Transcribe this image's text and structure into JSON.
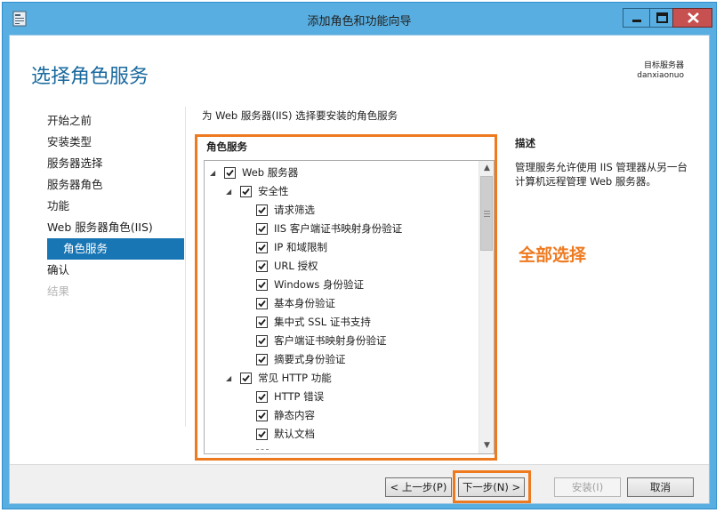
{
  "window": {
    "title": "添加角色和功能向导",
    "minimize_glyph": "minimize-icon",
    "maximize_glyph": "maximize-icon",
    "close_glyph": "close-icon"
  },
  "header": {
    "page_title": "选择角色服务",
    "target_label": "目标服务器",
    "target_server": "danxiaonuo"
  },
  "nav": {
    "items": [
      {
        "label": "开始之前",
        "state": "normal"
      },
      {
        "label": "安装类型",
        "state": "normal"
      },
      {
        "label": "服务器选择",
        "state": "normal"
      },
      {
        "label": "服务器角色",
        "state": "normal"
      },
      {
        "label": "功能",
        "state": "normal"
      },
      {
        "label": "Web 服务器角色(IIS)",
        "state": "normal"
      },
      {
        "label": "角色服务",
        "state": "active"
      },
      {
        "label": "确认",
        "state": "normal"
      },
      {
        "label": "结果",
        "state": "disabled"
      }
    ]
  },
  "main": {
    "instruction": "为 Web 服务器(IIS) 选择要安装的角色服务",
    "roles_heading": "角色服务",
    "tree": [
      {
        "label": "Web 服务器",
        "level": 0,
        "expanded": true,
        "checked": true
      },
      {
        "label": "安全性",
        "level": 1,
        "expanded": true,
        "checked": true
      },
      {
        "label": "请求筛选",
        "level": 2,
        "checked": true
      },
      {
        "label": "IIS 客户端证书映射身份验证",
        "level": 2,
        "checked": true
      },
      {
        "label": "IP 和域限制",
        "level": 2,
        "checked": true
      },
      {
        "label": "URL 授权",
        "level": 2,
        "checked": true
      },
      {
        "label": "Windows 身份验证",
        "level": 2,
        "checked": true
      },
      {
        "label": "基本身份验证",
        "level": 2,
        "checked": true
      },
      {
        "label": "集中式 SSL 证书支持",
        "level": 2,
        "checked": true
      },
      {
        "label": "客户端证书映射身份验证",
        "level": 2,
        "checked": true
      },
      {
        "label": "摘要式身份验证",
        "level": 2,
        "checked": true
      },
      {
        "label": "常见 HTTP 功能",
        "level": 1,
        "expanded": true,
        "checked": true
      },
      {
        "label": "HTTP 错误",
        "level": 2,
        "checked": true
      },
      {
        "label": "静态内容",
        "level": 2,
        "checked": true
      },
      {
        "label": "默认文档",
        "level": 2,
        "checked": true
      }
    ],
    "description_heading": "描述",
    "description_text": "管理服务允许使用 IIS 管理器从另一台计算机远程管理 Web 服务器。",
    "annotation": "全部选择"
  },
  "footer": {
    "prev_label": "< 上一步(P)",
    "next_label": "下一步(N) >",
    "install_label": "安装(I)",
    "cancel_label": "取消"
  },
  "colors": {
    "accent": "#1976b4",
    "frame_blue": "#58aee0",
    "highlight_orange": "#ee7a20",
    "close_red": "#c75050"
  }
}
